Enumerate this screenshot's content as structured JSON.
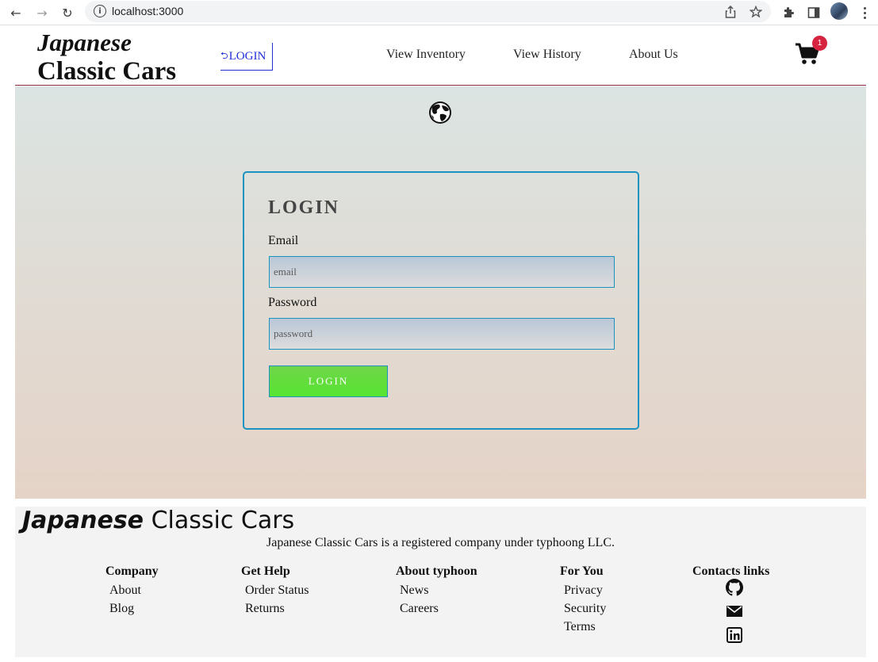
{
  "browser": {
    "url": "localhost:3000"
  },
  "header": {
    "logo_line1": "Japanese",
    "logo_line2": "Classic Cars",
    "login_symbol": "⮌",
    "login_label": "LOGIN",
    "nav": [
      {
        "label": "View Inventory"
      },
      {
        "label": "View History"
      },
      {
        "label": "About Us"
      }
    ],
    "cart_count": "1"
  },
  "login_form": {
    "title": "LOGIN",
    "email_label": "Email",
    "email_placeholder": "email",
    "password_label": "Password",
    "password_placeholder": "password",
    "submit_label": "LOGIN"
  },
  "footer": {
    "title_italic": "Japanese",
    "title_rest": " Classic Cars",
    "note": "Japanese Classic Cars is a registered company under typhoong LLC.",
    "columns": [
      {
        "heading": "Company",
        "links": [
          "About",
          "Blog"
        ]
      },
      {
        "heading": "Get Help",
        "links": [
          "Order Status",
          "Returns"
        ]
      },
      {
        "heading": "About typhoon",
        "links": [
          "News",
          "Careers"
        ]
      },
      {
        "heading": "For You",
        "links": [
          "Privacy",
          "Security",
          "Terms"
        ]
      }
    ],
    "contacts_heading": "Contacts links",
    "contact_icons": [
      "github-icon",
      "mail-icon",
      "linkedin-icon"
    ]
  },
  "colors": {
    "accent": "#1a93c0",
    "submit": "#66e03a",
    "badge": "#d62340",
    "login_link": "#1f2fd6"
  }
}
